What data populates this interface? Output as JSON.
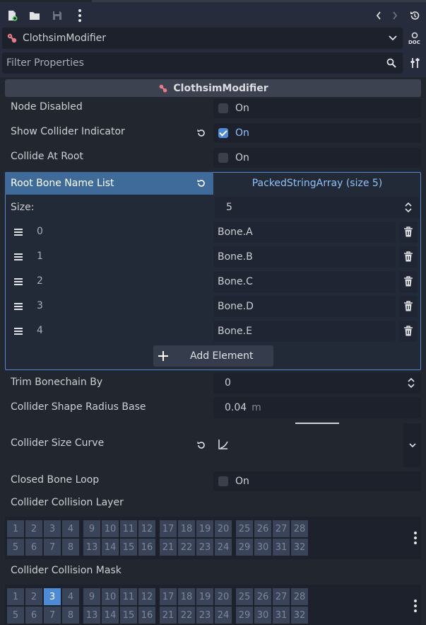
{
  "object": {
    "name": "ClothsimModifier"
  },
  "filter": {
    "placeholder": "Filter Properties"
  },
  "header": {
    "title": "ClothsimModifier"
  },
  "properties": {
    "node_disabled": {
      "label": "Node Disabled",
      "value": "On",
      "checked": false
    },
    "show_collider_indicator": {
      "label": "Show Collider Indicator",
      "value": "On",
      "checked": true
    },
    "collide_at_root": {
      "label": "Collide At Root",
      "value": "On",
      "checked": false
    },
    "root_bone_name_list": {
      "label": "Root Bone Name List",
      "value": "PackedStringArray (size 5)"
    },
    "trim_bonechain_by": {
      "label": "Trim Bonechain By",
      "value": "0"
    },
    "collider_shape_radius_base": {
      "label": "Collider Shape Radius Base",
      "value": "0.04",
      "unit": "m"
    },
    "collider_size_curve": {
      "label": "Collider Size Curve"
    },
    "closed_bone_loop": {
      "label": "Closed Bone Loop",
      "value": "On",
      "checked": false
    },
    "collider_collision_layer": {
      "label": "Collider Collision Layer",
      "selected": []
    },
    "collider_collision_mask": {
      "label": "Collider Collision Mask",
      "selected": [
        3
      ]
    }
  },
  "array": {
    "size_label": "Size:",
    "size_value": "5",
    "items": [
      {
        "index": "0",
        "value": "Bone.A"
      },
      {
        "index": "1",
        "value": "Bone.B"
      },
      {
        "index": "2",
        "value": "Bone.C"
      },
      {
        "index": "3",
        "value": "Bone.D"
      },
      {
        "index": "4",
        "value": "Bone.E"
      }
    ],
    "add_label": "Add Element"
  },
  "layers": {
    "row1": [
      "1",
      "2",
      "3",
      "4",
      "9",
      "10",
      "11",
      "12",
      "17",
      "18",
      "19",
      "20",
      "25",
      "26",
      "27",
      "28"
    ],
    "row2": [
      "5",
      "6",
      "7",
      "8",
      "13",
      "14",
      "15",
      "16",
      "21",
      "22",
      "23",
      "24",
      "29",
      "30",
      "31",
      "32"
    ]
  },
  "icons": {
    "new_script": "new-file-icon",
    "open": "folder-icon",
    "save": "save-icon",
    "menu": "kebab-menu-icon",
    "history_back": "chevron-left-icon",
    "history_forward": "chevron-right-icon",
    "history": "history-icon",
    "doc": "doc-icon"
  },
  "colors": {
    "accent": "#4d8bd7",
    "panel": "#21262f",
    "field": "#1c212b",
    "selected_header": "#3f6b9a"
  }
}
